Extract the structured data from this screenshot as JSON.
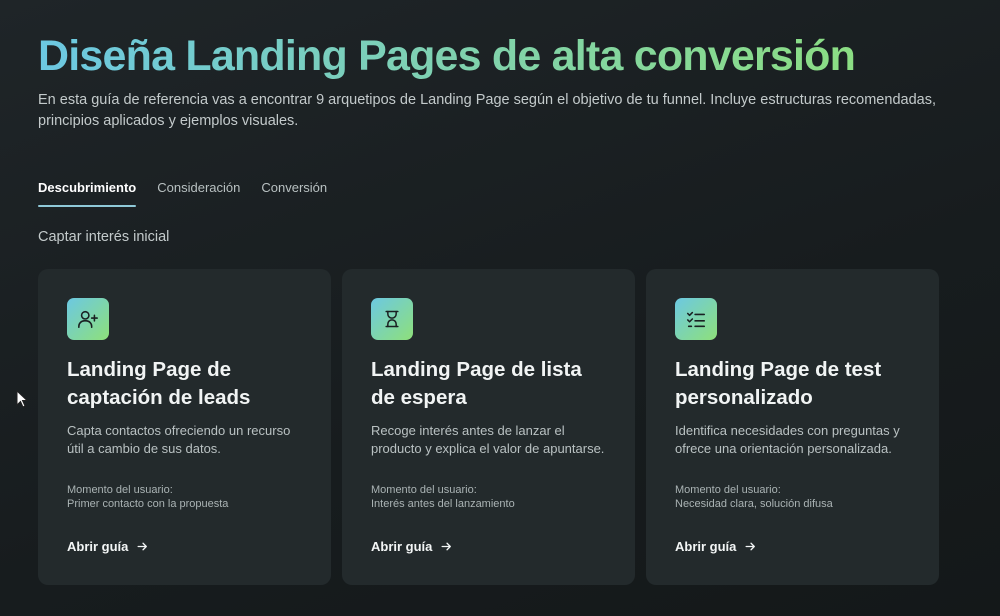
{
  "header": {
    "title": "Diseña Landing Pages de alta conversión",
    "intro": "En esta guía de referencia vas a encontrar 9 arquetipos de Landing Page según el objetivo de tu funnel. Incluye estructuras recomendadas, principios aplicados y ejemplos visuales."
  },
  "tabs": [
    {
      "label": "Descubrimiento",
      "active": true
    },
    {
      "label": "Consideración",
      "active": false
    },
    {
      "label": "Conversión",
      "active": false
    }
  ],
  "section_label": "Captar interés inicial",
  "cards": [
    {
      "icon": "user-plus-icon",
      "title": "Landing Page de captación de leads",
      "description": "Capta contactos ofreciendo un recurso útil a cambio de sus datos.",
      "moment_label": "Momento del usuario:",
      "moment_value": "Primer contacto con la propuesta",
      "link_label": "Abrir guía"
    },
    {
      "icon": "hourglass-icon",
      "title": "Landing Page de lista de espera",
      "description": "Recoge interés antes de lanzar el producto y explica el valor de apuntarse.",
      "moment_label": "Momento del usuario:",
      "moment_value": "Interés antes del lanzamiento",
      "link_label": "Abrir guía"
    },
    {
      "icon": "checklist-icon",
      "title": "Landing Page de test personalizado",
      "description": "Identifica necesidades con preguntas y ofrece una orientación personalizada.",
      "moment_label": "Momento del usuario:",
      "moment_value": "Necesidad clara, solución difusa",
      "link_label": "Abrir guía"
    }
  ],
  "colors": {
    "background": "#1b2123",
    "card": "#232a2c",
    "gradient_start": "#6cc8e2",
    "gradient_end": "#8ee07a",
    "tab_underline": "#8fc9d8"
  }
}
